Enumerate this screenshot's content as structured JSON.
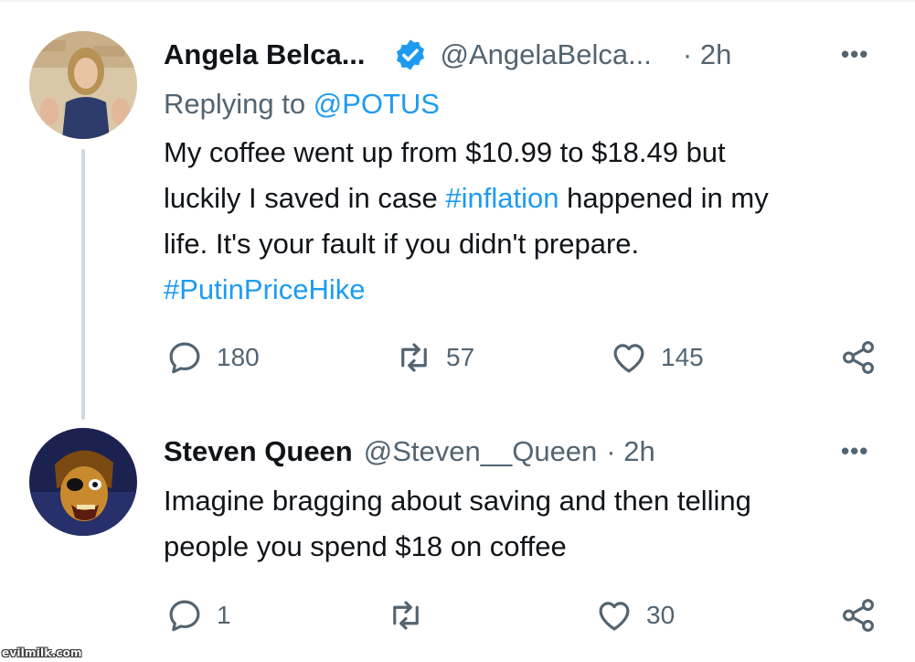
{
  "colors": {
    "link": "#1d9bf0",
    "muted": "#536471",
    "text": "#0f1419",
    "thread_line": "#cfd9de"
  },
  "tweets": [
    {
      "name": "Angela Belca...",
      "verified": true,
      "handle": "@AngelaBelca...",
      "time": "· 2h",
      "more": "•••",
      "replying_prefix": "Replying to ",
      "replying_to": "@POTUS",
      "text_lines": [
        {
          "pre": "My coffee went up from $10.99 to $18.49 but",
          "tag": "",
          "post": ""
        },
        {
          "pre": "luckily I saved in case ",
          "tag": "#inflation",
          "post": " happened in my"
        },
        {
          "pre": "life. It's your fault if you didn't prepare.",
          "tag": "",
          "post": ""
        },
        {
          "pre": "",
          "tag": "#PutinPriceHike",
          "post": ""
        }
      ],
      "actions": {
        "reply_count": "180",
        "retweet_count": "57",
        "like_count": "145"
      },
      "icons": [
        "reply-icon",
        "retweet-icon",
        "like-icon",
        "share-icon"
      ]
    },
    {
      "name": "Steven Queen",
      "verified": false,
      "handle": "@Steven__Queen",
      "time": "· 2h",
      "more": "•••",
      "text_lines": [
        "Imagine bragging about saving and then telling",
        "people you spend $18 on coffee"
      ],
      "actions": {
        "reply_count": "1",
        "retweet_count": "",
        "like_count": "30"
      },
      "icons": [
        "reply-icon",
        "retweet-icon",
        "like-icon",
        "share-icon"
      ]
    }
  ],
  "watermark": "evilmilk.com"
}
